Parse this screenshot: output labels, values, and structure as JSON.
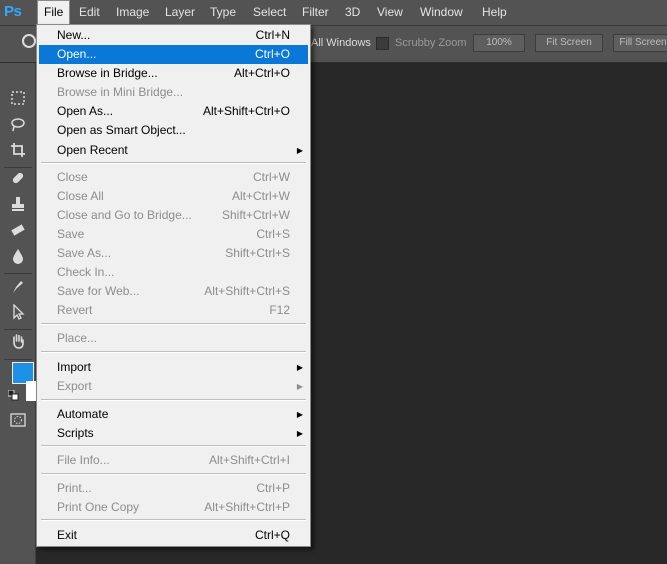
{
  "app": {
    "logo": "Ps"
  },
  "menubar": [
    {
      "label": "File",
      "active": true
    },
    {
      "label": "Edit"
    },
    {
      "label": "Image"
    },
    {
      "label": "Layer"
    },
    {
      "label": "Type"
    },
    {
      "label": "Select"
    },
    {
      "label": "Filter"
    },
    {
      "label": "3D"
    },
    {
      "label": "View"
    },
    {
      "label": "Window"
    },
    {
      "label": "Help"
    }
  ],
  "options": {
    "all_windows": "All Windows",
    "scrubby_zoom": "Scrubby Zoom",
    "zoom_100": "100%",
    "fit_screen": "Fit Screen",
    "fill_screen": "Fill Screen"
  },
  "file_menu": [
    {
      "label": "New...",
      "shortcut": "Ctrl+N",
      "enabled": true
    },
    {
      "label": "Open...",
      "shortcut": "Ctrl+O",
      "enabled": true,
      "highlighted": true
    },
    {
      "label": "Browse in Bridge...",
      "shortcut": "Alt+Ctrl+O",
      "enabled": true
    },
    {
      "label": "Browse in Mini Bridge...",
      "shortcut": "",
      "enabled": false
    },
    {
      "label": "Open As...",
      "shortcut": "Alt+Shift+Ctrl+O",
      "enabled": true
    },
    {
      "label": "Open as Smart Object...",
      "shortcut": "",
      "enabled": true
    },
    {
      "label": "Open Recent",
      "shortcut": "",
      "enabled": true,
      "submenu": true
    },
    {
      "label": "Close",
      "shortcut": "Ctrl+W",
      "enabled": false
    },
    {
      "label": "Close All",
      "shortcut": "Alt+Ctrl+W",
      "enabled": false
    },
    {
      "label": "Close and Go to Bridge...",
      "shortcut": "Shift+Ctrl+W",
      "enabled": false
    },
    {
      "label": "Save",
      "shortcut": "Ctrl+S",
      "enabled": false
    },
    {
      "label": "Save As...",
      "shortcut": "Shift+Ctrl+S",
      "enabled": false
    },
    {
      "label": "Check In...",
      "shortcut": "",
      "enabled": false
    },
    {
      "label": "Save for Web...",
      "shortcut": "Alt+Shift+Ctrl+S",
      "enabled": false
    },
    {
      "label": "Revert",
      "shortcut": "F12",
      "enabled": false
    },
    {
      "label": "Place...",
      "shortcut": "",
      "enabled": false
    },
    {
      "label": "Import",
      "shortcut": "",
      "enabled": true,
      "submenu": true
    },
    {
      "label": "Export",
      "shortcut": "",
      "enabled": false,
      "submenu": true
    },
    {
      "label": "Automate",
      "shortcut": "",
      "enabled": true,
      "submenu": true
    },
    {
      "label": "Scripts",
      "shortcut": "",
      "enabled": true,
      "submenu": true
    },
    {
      "label": "File Info...",
      "shortcut": "Alt+Shift+Ctrl+I",
      "enabled": false
    },
    {
      "label": "Print...",
      "shortcut": "Ctrl+P",
      "enabled": false
    },
    {
      "label": "Print One Copy",
      "shortcut": "Alt+Shift+Ctrl+P",
      "enabled": false
    },
    {
      "label": "Exit",
      "shortcut": "Ctrl+Q",
      "enabled": true
    }
  ],
  "tools": [
    "zoom-icon",
    "marquee-icon",
    "lasso-icon",
    "crop-icon",
    "healing-brush-icon",
    "clone-stamp-icon",
    "eraser-icon",
    "blur-icon",
    "pen-icon",
    "path-selection-icon",
    "hand-icon"
  ],
  "colors": {
    "foreground": "#1e90e8",
    "background": "#ffffff",
    "highlight": "#0a78d7",
    "logo": "#31a8ff"
  }
}
